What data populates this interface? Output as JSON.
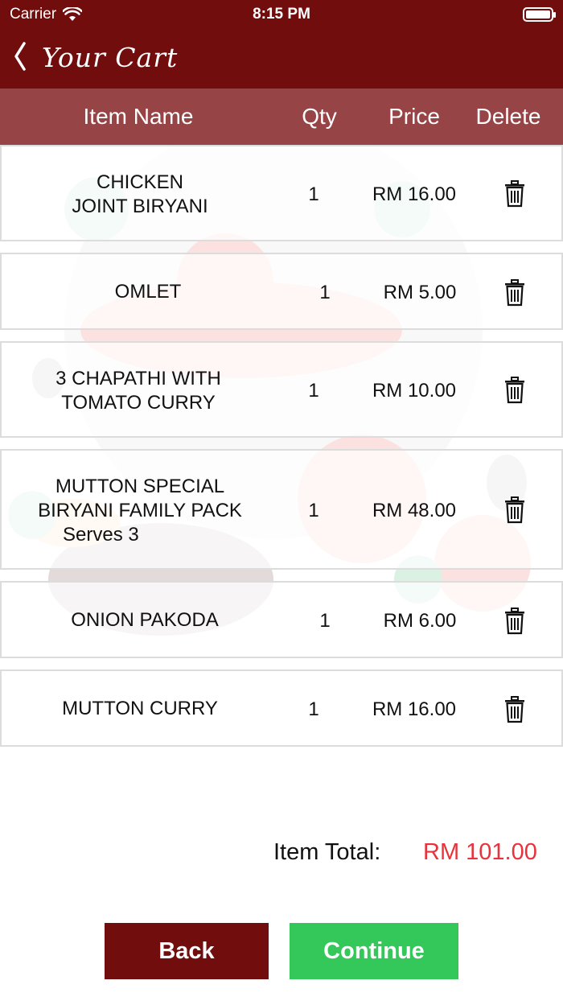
{
  "status_bar": {
    "carrier": "Carrier",
    "time": "8:15 PM"
  },
  "nav": {
    "title": "Your Cart"
  },
  "table_header": {
    "item_name": "Item Name",
    "qty": "Qty",
    "price": "Price",
    "delete": "Delete"
  },
  "items": [
    {
      "name_lines": [
        "CHICKEN",
        "JOINT BIRYANI"
      ],
      "qty": "1",
      "price": "RM 16.00"
    },
    {
      "name_lines": [
        "OMLET"
      ],
      "qty": "1",
      "price": "RM 5.00"
    },
    {
      "name_lines": [
        "3 CHAPATHI WITH",
        "TOMATO CURRY"
      ],
      "qty": "1",
      "price": "RM 10.00"
    },
    {
      "name_lines": [
        "MUTTON SPECIAL",
        "BIRYANI FAMILY PACK",
        "Serves 3"
      ],
      "qty": "1",
      "price": "RM 48.00"
    },
    {
      "name_lines": [
        "ONION PAKODA"
      ],
      "qty": "1",
      "price": "RM 6.00"
    },
    {
      "name_lines": [
        "MUTTON CURRY"
      ],
      "qty": "1",
      "price": "RM 16.00"
    }
  ],
  "totals": {
    "label": "Item Total:",
    "value": "RM 101.00"
  },
  "buttons": {
    "back": "Back",
    "continue": "Continue"
  },
  "colors": {
    "brand": "#720d0d",
    "header": "#964446",
    "total": "#e8323c",
    "continue": "#34c759"
  },
  "icons": {
    "back": "chevron-left-icon",
    "delete": "trash-icon",
    "wifi": "wifi-icon",
    "battery": "battery-icon"
  }
}
